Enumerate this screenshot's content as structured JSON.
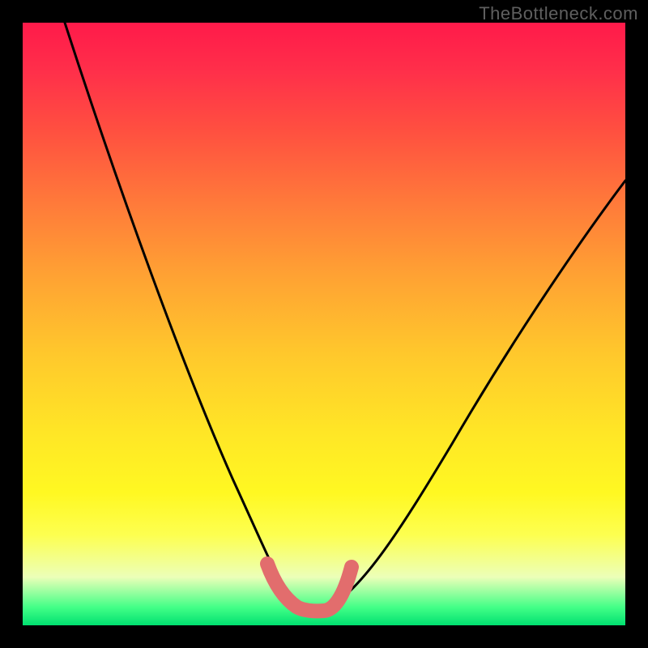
{
  "watermark": "TheBottleneck.com",
  "chart_data": {
    "type": "line",
    "title": "",
    "xlabel": "",
    "ylabel": "",
    "xlim": [
      0,
      100
    ],
    "ylim": [
      0,
      100
    ],
    "grid": false,
    "legend": false,
    "annotations": [],
    "series": [
      {
        "name": "left-curve",
        "color": "#000000",
        "x": [
          7,
          12,
          17,
          22,
          27,
          31,
          34,
          37,
          40,
          42,
          44,
          45.5
        ],
        "y": [
          100,
          83,
          68,
          54,
          41,
          30,
          22,
          15,
          9,
          5,
          3,
          2.4
        ]
      },
      {
        "name": "right-curve",
        "color": "#000000",
        "x": [
          50,
          52,
          55,
          59,
          64,
          70,
          77,
          85,
          93,
          100
        ],
        "y": [
          2.4,
          3,
          6,
          11,
          19,
          29,
          41,
          53,
          65,
          74
        ]
      },
      {
        "name": "trough-highlight",
        "color": "#e26d6d",
        "x": [
          40.5,
          41.5,
          42.5,
          43.5,
          45,
          46.5,
          48,
          49,
          50,
          51,
          52,
          53.5,
          54.5
        ],
        "y": [
          10,
          7.5,
          5.5,
          4,
          2.6,
          2.3,
          2.3,
          2.3,
          2.3,
          3,
          4.5,
          7,
          9.5
        ]
      }
    ],
    "background_gradient": {
      "top": "#ff1a4a",
      "bottom": "#00e070"
    }
  }
}
